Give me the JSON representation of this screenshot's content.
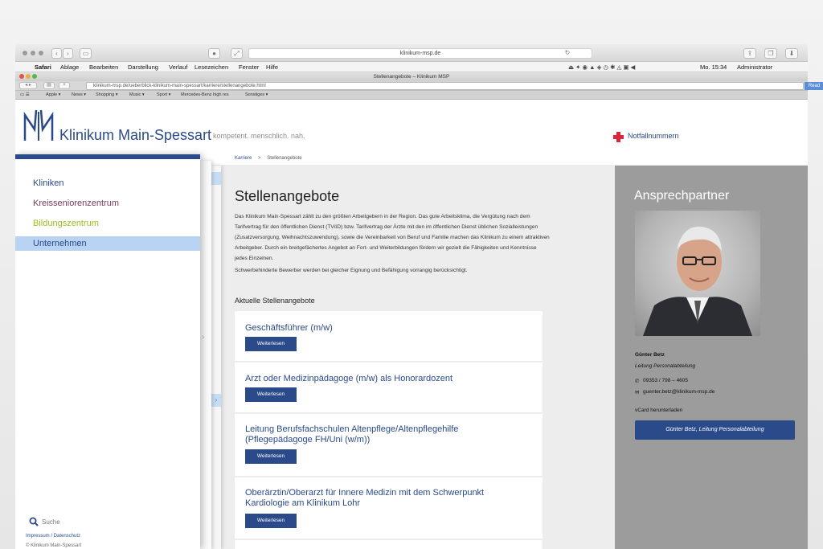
{
  "browser": {
    "url_display": "klinikum-msp.de",
    "window_title": "Stellenangebote – Klinikum MSP",
    "address_full": "klinikum-msp.de/ueberblick-klinikum-main-spessart/karriere/stellenangebote.html",
    "read_label": "Read",
    "bookmarks": [
      "Apple ▾",
      "News ▾",
      "Shopping ▾",
      "Music ▾",
      "Sport ▾",
      "Mercedes-Benz high res",
      "Sonstiges ▾"
    ]
  },
  "menubar": {
    "items": [
      "Safari",
      "Ablage",
      "Bearbeiten",
      "Darstellung",
      "Verlauf",
      "Lesezeichen",
      "Fenster",
      "Hilfe"
    ],
    "clock": "Mo. 15:34",
    "user": "Administrator"
  },
  "site": {
    "logo_name": "Klinikum Main-Spessart",
    "tagline": "kompetent. menschlich. nah.",
    "emergency": "Notfallnummern",
    "breadcrumb": [
      "Karriere",
      ">",
      "Stellenangebote"
    ]
  },
  "nav": {
    "items": [
      {
        "label": "Kliniken",
        "color": "#2a4a8a"
      },
      {
        "label": "Kreisseniorenzentrum",
        "color": "#7a3a5e"
      },
      {
        "label": "Bildungszentrum",
        "color": "#9ac01c"
      },
      {
        "label": "Unternehmen",
        "color": "#2a4a8a"
      }
    ],
    "search_placeholder": "Suche",
    "footer_links": "Impressum / Datenschutz",
    "copyright": "© Klinikum Main-Spessart"
  },
  "main": {
    "title": "Stellenangebote",
    "intro": "Das Klinikum Main-Spessart zählt zu den größten Arbeitgebern in der Region. Das gute Arbeitsklima, die Vergütung nach dem Tarifvertrag für den öffentlichen Dienst (TVöD) bzw. Tarifvertrag der Ärzte mit den im öffentlichen Dienst üblichen Sozialleistungen (Zusatzversorgung, Weihnachtszuwendung), sowie die Vereinbarkeit von Beruf und Familie machen das Klinikum zu einem attraktiven Arbeitgeber. Durch ein breitgefächertes Angebot an Fort- und Weiterbildungen fördern wir gezielt die Fähigkeiten und Kenntnisse jedes Einzelnen.",
    "note": "Schwerbehinderte Bewerber werden bei gleicher Eignung und Befähigung vorrangig berücksichtigt.",
    "current_heading": "Aktuelle Stellenangebote",
    "button_label": "Weiterlesen",
    "jobs": [
      {
        "title": "Geschäftsführer (m/w)"
      },
      {
        "title": "Arzt oder Medizinpädagoge (m/w) als Honorardozent"
      },
      {
        "title": "Leitung Berufsfachschulen Altenpflege/Altenpflegehilfe (Pflegepädagoge FH/Uni (w/m))"
      },
      {
        "title": "Oberärztin/Oberarzt für Innere Medizin mit dem Schwerpunkt Kardiologie am Klinikum Lohr"
      }
    ]
  },
  "contact": {
    "heading": "Ansprechpartner",
    "name": "Günter Betz",
    "role": "Leitung Personalabteilung",
    "phone": "09353 / 798 – 4605",
    "email": "guenter.betz@klinikum-msp.de",
    "vcard": "vCard herunterladen",
    "button": "Günter Betz, Leitung Personalabteilung"
  },
  "colors": {
    "brand_blue": "#2a4a8a",
    "accent_red": "#d9263a",
    "sidebar_grey": "#9c9c9c"
  }
}
